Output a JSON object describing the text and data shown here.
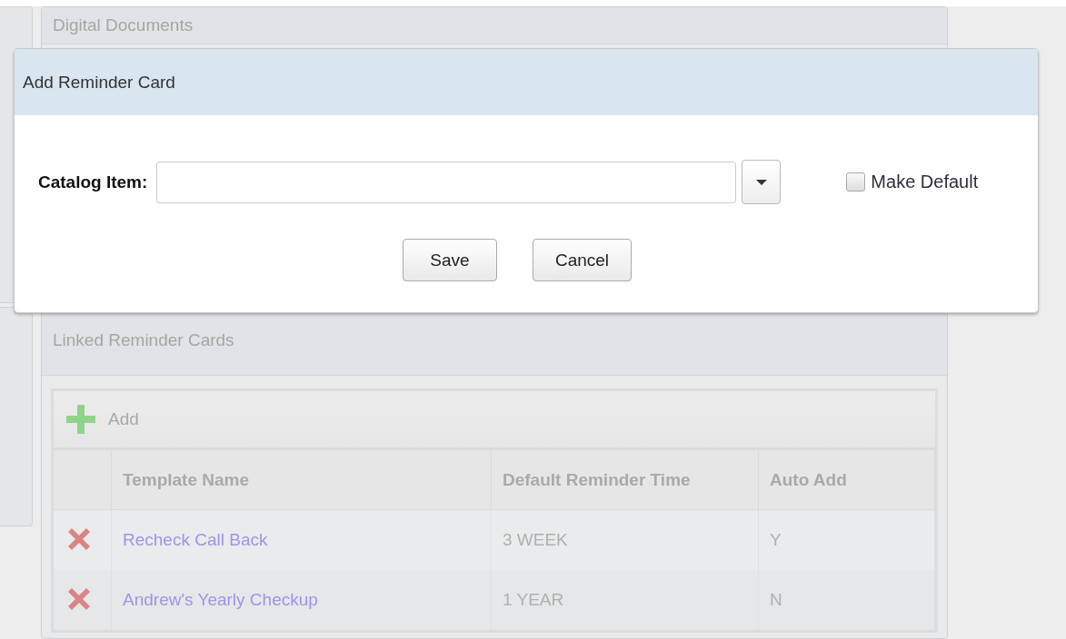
{
  "background_panels": [
    {
      "title": "Digital Documents"
    }
  ],
  "linked_reminder_cards": {
    "title": "Linked Reminder Cards",
    "toolbar": {
      "add_label": "Add"
    },
    "table": {
      "columns": [
        "Template Name",
        "Default Reminder Time",
        "Auto Add"
      ],
      "rows": [
        {
          "template_name": "Recheck Call Back",
          "default_reminder_time": "3 WEEK",
          "auto_add": "Y"
        },
        {
          "template_name": "Andrew's Yearly Checkup",
          "default_reminder_time": "1 YEAR",
          "auto_add": "N"
        }
      ]
    }
  },
  "dialog": {
    "title": "Add Reminder Card",
    "catalog_item": {
      "label": "Catalog Item:"
    },
    "make_default": {
      "label": "Make Default",
      "checked": false
    },
    "buttons": [
      "Save",
      "Cancel"
    ]
  }
}
